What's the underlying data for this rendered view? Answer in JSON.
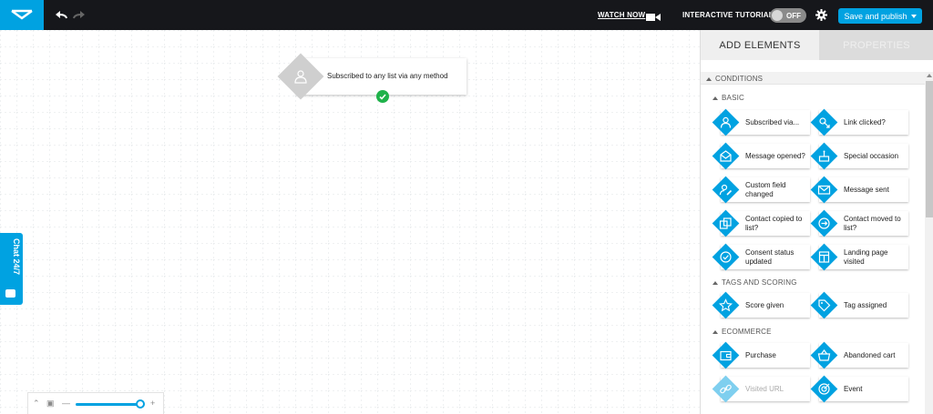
{
  "topbar": {
    "watch_label": "WATCH NOW",
    "tutorial_label": "INTERACTIVE TUTORIAL",
    "tutorial_toggle": "OFF",
    "publish_label": "Save and publish"
  },
  "canvas": {
    "node_label": "Subscribed to any list via any method",
    "chat_label": "Chat 24/7"
  },
  "panel": {
    "tab_add": "ADD ELEMENTS",
    "tab_props": "PROPERTIES",
    "conditions_label": "CONDITIONS",
    "basic_label": "BASIC",
    "tags_label": "TAGS AND SCORING",
    "ecommerce_label": "ECOMMERCE",
    "basic_items": [
      {
        "label": "Subscribed via...",
        "icon": "person-icon"
      },
      {
        "label": "Link clicked?",
        "icon": "link-click-icon"
      },
      {
        "label": "Message opened?",
        "icon": "envelope-open-icon"
      },
      {
        "label": "Special occasion",
        "icon": "cake-icon"
      },
      {
        "label": "Custom field changed",
        "icon": "person-edit-icon"
      },
      {
        "label": "Message sent",
        "icon": "envelope-icon"
      },
      {
        "label": "Contact copied to list?",
        "icon": "copy-icon"
      },
      {
        "label": "Contact moved to list?",
        "icon": "arrow-circle-icon"
      },
      {
        "label": "Consent status updated",
        "icon": "check-circle-icon"
      },
      {
        "label": "Landing page visited",
        "icon": "page-icon"
      }
    ],
    "tag_items": [
      {
        "label": "Score given",
        "icon": "star-icon"
      },
      {
        "label": "Tag assigned",
        "icon": "tag-icon"
      }
    ],
    "ecom_items": [
      {
        "label": "Purchase",
        "icon": "wallet-icon"
      },
      {
        "label": "Abandoned cart",
        "icon": "basket-icon"
      },
      {
        "label": "Visited URL",
        "icon": "link-icon"
      },
      {
        "label": "Event",
        "icon": "target-icon"
      }
    ]
  },
  "colors": {
    "accent": "#00a2e1",
    "topbar": "#16171b",
    "success": "#1fb24a"
  }
}
